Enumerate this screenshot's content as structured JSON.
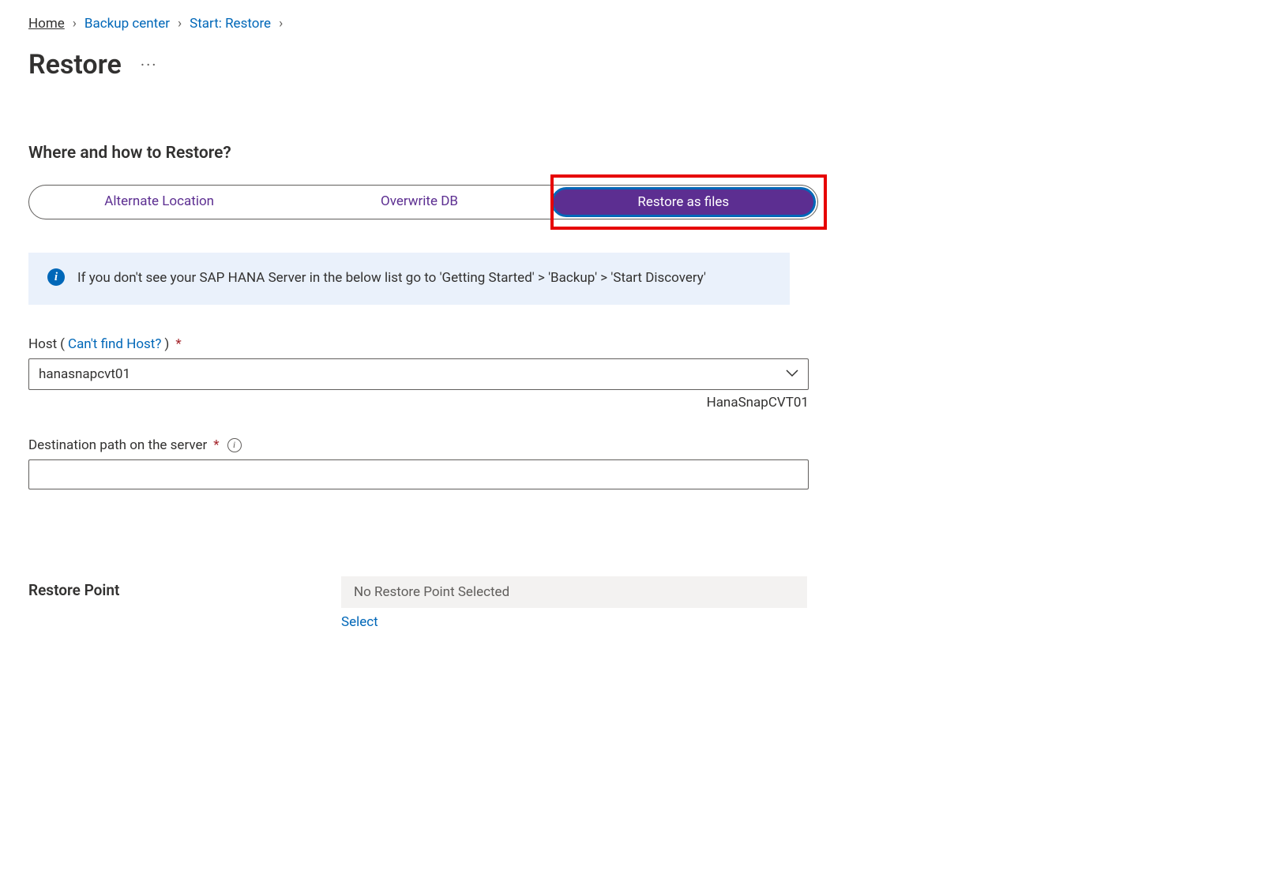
{
  "breadcrumb": {
    "home": "Home",
    "backup_center": "Backup center",
    "start_restore": "Start: Restore"
  },
  "page_title": "Restore",
  "section_heading": "Where and how to Restore?",
  "pills": {
    "alternate_location": "Alternate Location",
    "overwrite_db": "Overwrite DB",
    "restore_as_files": "Restore as files"
  },
  "info_banner": "If you don't see your SAP HANA Server in the below list go to 'Getting Started' > 'Backup' > 'Start Discovery'",
  "host_field": {
    "label_prefix": "Host ",
    "link_text": "Can't find Host?",
    "value": "hanasnapcvt01",
    "helper": "HanaSnapCVT01"
  },
  "dest_path_field": {
    "label": "Destination path on the server",
    "value": ""
  },
  "restore_point": {
    "label": "Restore Point",
    "value": "No Restore Point Selected",
    "select_link": "Select"
  }
}
